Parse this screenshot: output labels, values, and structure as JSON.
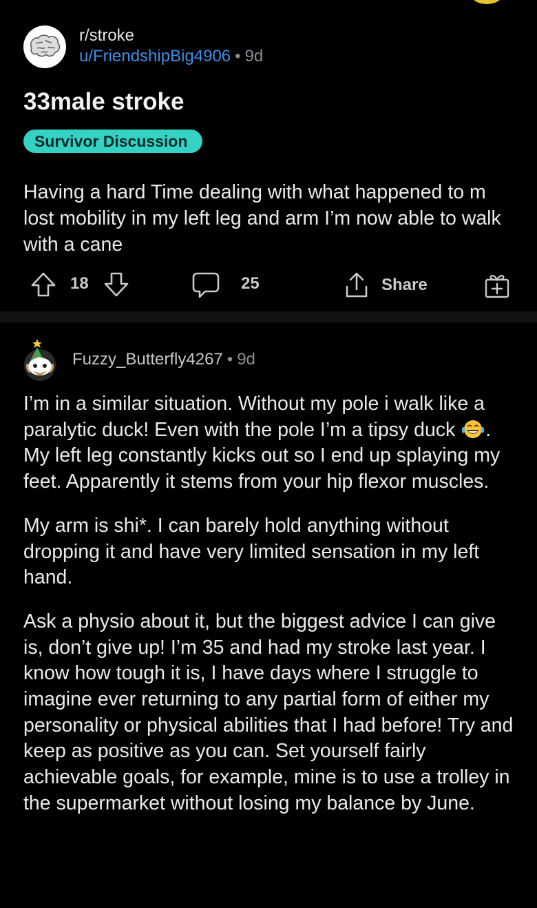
{
  "post": {
    "subreddit": "r/stroke",
    "author": "u/FriendshipBig4906",
    "separator": "•",
    "age": "9d",
    "title": "33male stroke",
    "flair": "Survivor Discussion",
    "body": "Having a hard Time dealing with what happened to m lost mobility in my left leg and arm I’m now able to walk with a cane",
    "upvotes": "18",
    "comments": "25",
    "share_label": "Share"
  },
  "comment": {
    "author": "Fuzzy_Butterfly4267",
    "separator": "•",
    "age": "9d",
    "p1_before_emoji": "I’m in a similar situation.  Without my pole i walk like a paralytic duck! Even with the pole I’m a tipsy duck",
    "p1_after_emoji": ".  My left leg constantly kicks out so I end up splaying my feet.  Apparently it stems from your hip flexor muscles.",
    "p2": "My arm is shi*.  I can barely hold anything without dropping it and have very limited sensation in my left hand.",
    "p3": "Ask a physio about it,  but the biggest advice I can give is, don’t give up!  I’m 35 and had my stroke last year.  I know how tough it is, I have days where I struggle to imagine ever returning to any partial form of either my personality or physical abilities that I had before! Try and keep as positive as you can.  Set yourself fairly achievable goals, for example, mine is to use a trolley in the supermarket without losing my balance by June."
  },
  "icons": {
    "upvote": "arrow-up-icon",
    "downvote": "arrow-down-icon",
    "comment": "speech-bubble-icon",
    "share": "share-icon",
    "award": "gift-icon",
    "emoji": "laughing-tears-emoji"
  },
  "colors": {
    "background": "#000000",
    "link": "#3b8ee6",
    "flair": "#33d2c4",
    "muted": "#8b8f93"
  }
}
